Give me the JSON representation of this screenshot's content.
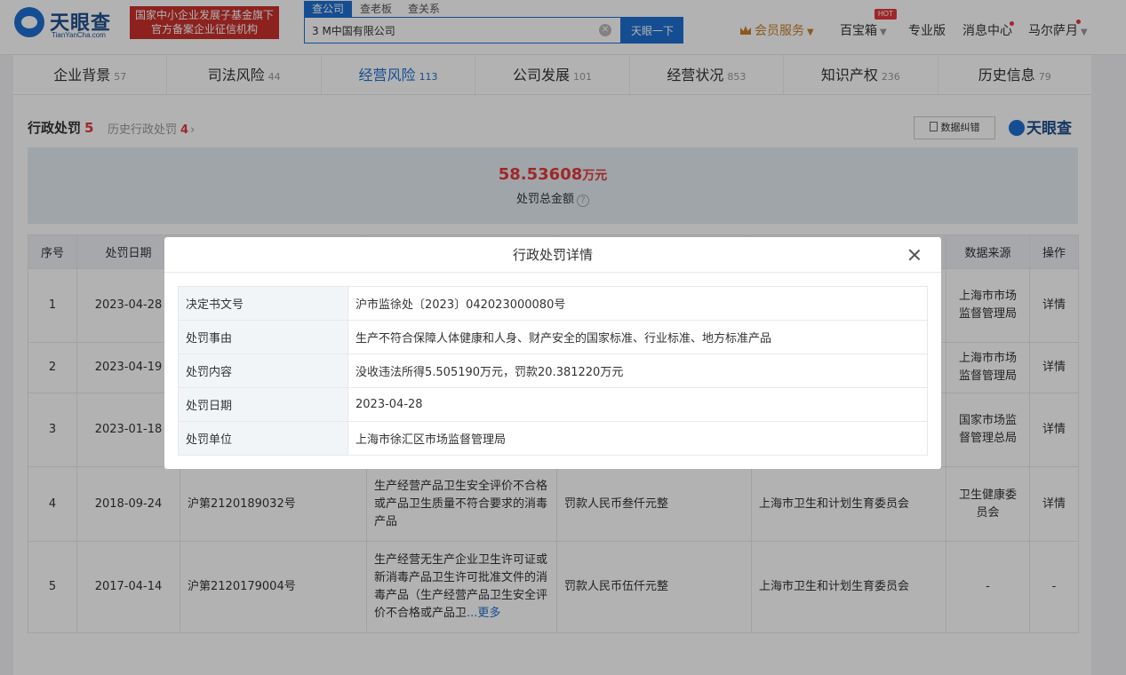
{
  "header": {
    "logo_cn": "天眼查",
    "logo_en": "TianYanCha.com",
    "badge_line1": "国家中小企业发展子基金旗下",
    "badge_line2": "官方备案企业征信机构",
    "search_tabs": [
      "查公司",
      "查老板",
      "查关系"
    ],
    "search_value": "3 M中国有限公司",
    "search_button": "天眼一下",
    "nav": {
      "vip": "会员服务",
      "treasure": "百宝箱",
      "hot": "HOT",
      "pro": "专业版",
      "messages": "消息中心",
      "user": "马尔萨月"
    }
  },
  "tabs": [
    {
      "label": "企业背景",
      "count": "57"
    },
    {
      "label": "司法风险",
      "count": "44"
    },
    {
      "label": "经营风险",
      "count": "113"
    },
    {
      "label": "公司发展",
      "count": "101"
    },
    {
      "label": "经营状况",
      "count": "853"
    },
    {
      "label": "知识产权",
      "count": "236"
    },
    {
      "label": "历史信息",
      "count": "79"
    }
  ],
  "section": {
    "title": "行政处罚",
    "count": "5",
    "history_label": "历史行政处罚",
    "history_count": "4",
    "chevron": "›",
    "correction": "数据纠错",
    "brand": "天眼查"
  },
  "summary": {
    "amount": "58.53608",
    "unit": "万元",
    "label": "处罚总金额",
    "help": "?"
  },
  "table": {
    "headers": [
      "序号",
      "处罚日期",
      "数据来源",
      "操作"
    ],
    "rows": [
      {
        "no": "1",
        "date": "2023-04-28",
        "doc": "",
        "reason": "",
        "content": "",
        "unit": "",
        "source": "上海市市场监督管理局",
        "action": "详情"
      },
      {
        "no": "2",
        "date": "2023-04-19",
        "doc": "",
        "reason": "",
        "content": "",
        "unit": "",
        "source": "上海市市场监督管理局",
        "action": "详情"
      },
      {
        "no": "3",
        "date": "2023-01-18",
        "doc": "",
        "reason": "",
        "content": "",
        "unit": "",
        "source": "国家市场监督管理总局",
        "action": "详情"
      },
      {
        "no": "4",
        "date": "2018-09-24",
        "doc": "沪第2120189032号",
        "reason": "生产经营产品卫生安全评价不合格或产品卫生质量不符合要求的消毒产品",
        "content": "罚款人民币叁仟元整",
        "unit": "上海市卫生和计划生育委员会",
        "source": "卫生健康委员会",
        "action": "详情"
      },
      {
        "no": "5",
        "date": "2017-04-14",
        "doc": "沪第2120179004号",
        "reason": "生产经营无生产企业卫生许可证或新消毒产品卫生许可批准文件的消毒产品（生产经营产品卫生安全评价不合格或产品卫",
        "more": "...更多",
        "content": "罚款人民币伍仟元整",
        "unit": "上海市卫生和计划生育委员会",
        "source": "-",
        "action": "-"
      }
    ]
  },
  "modal": {
    "title": "行政处罚详情",
    "rows": [
      {
        "key": "决定书文号",
        "value": "沪市监徐处〔2023〕042023000080号"
      },
      {
        "key": "处罚事由",
        "value": "生产不符合保障人体健康和人身、财产安全的国家标准、行业标准、地方标准产品"
      },
      {
        "key": "处罚内容",
        "value": "没收违法所得5.505190万元，罚款20.381220万元"
      },
      {
        "key": "处罚日期",
        "value": "2023-04-28"
      },
      {
        "key": "处罚单位",
        "value": "上海市徐汇区市场监督管理局"
      }
    ]
  }
}
